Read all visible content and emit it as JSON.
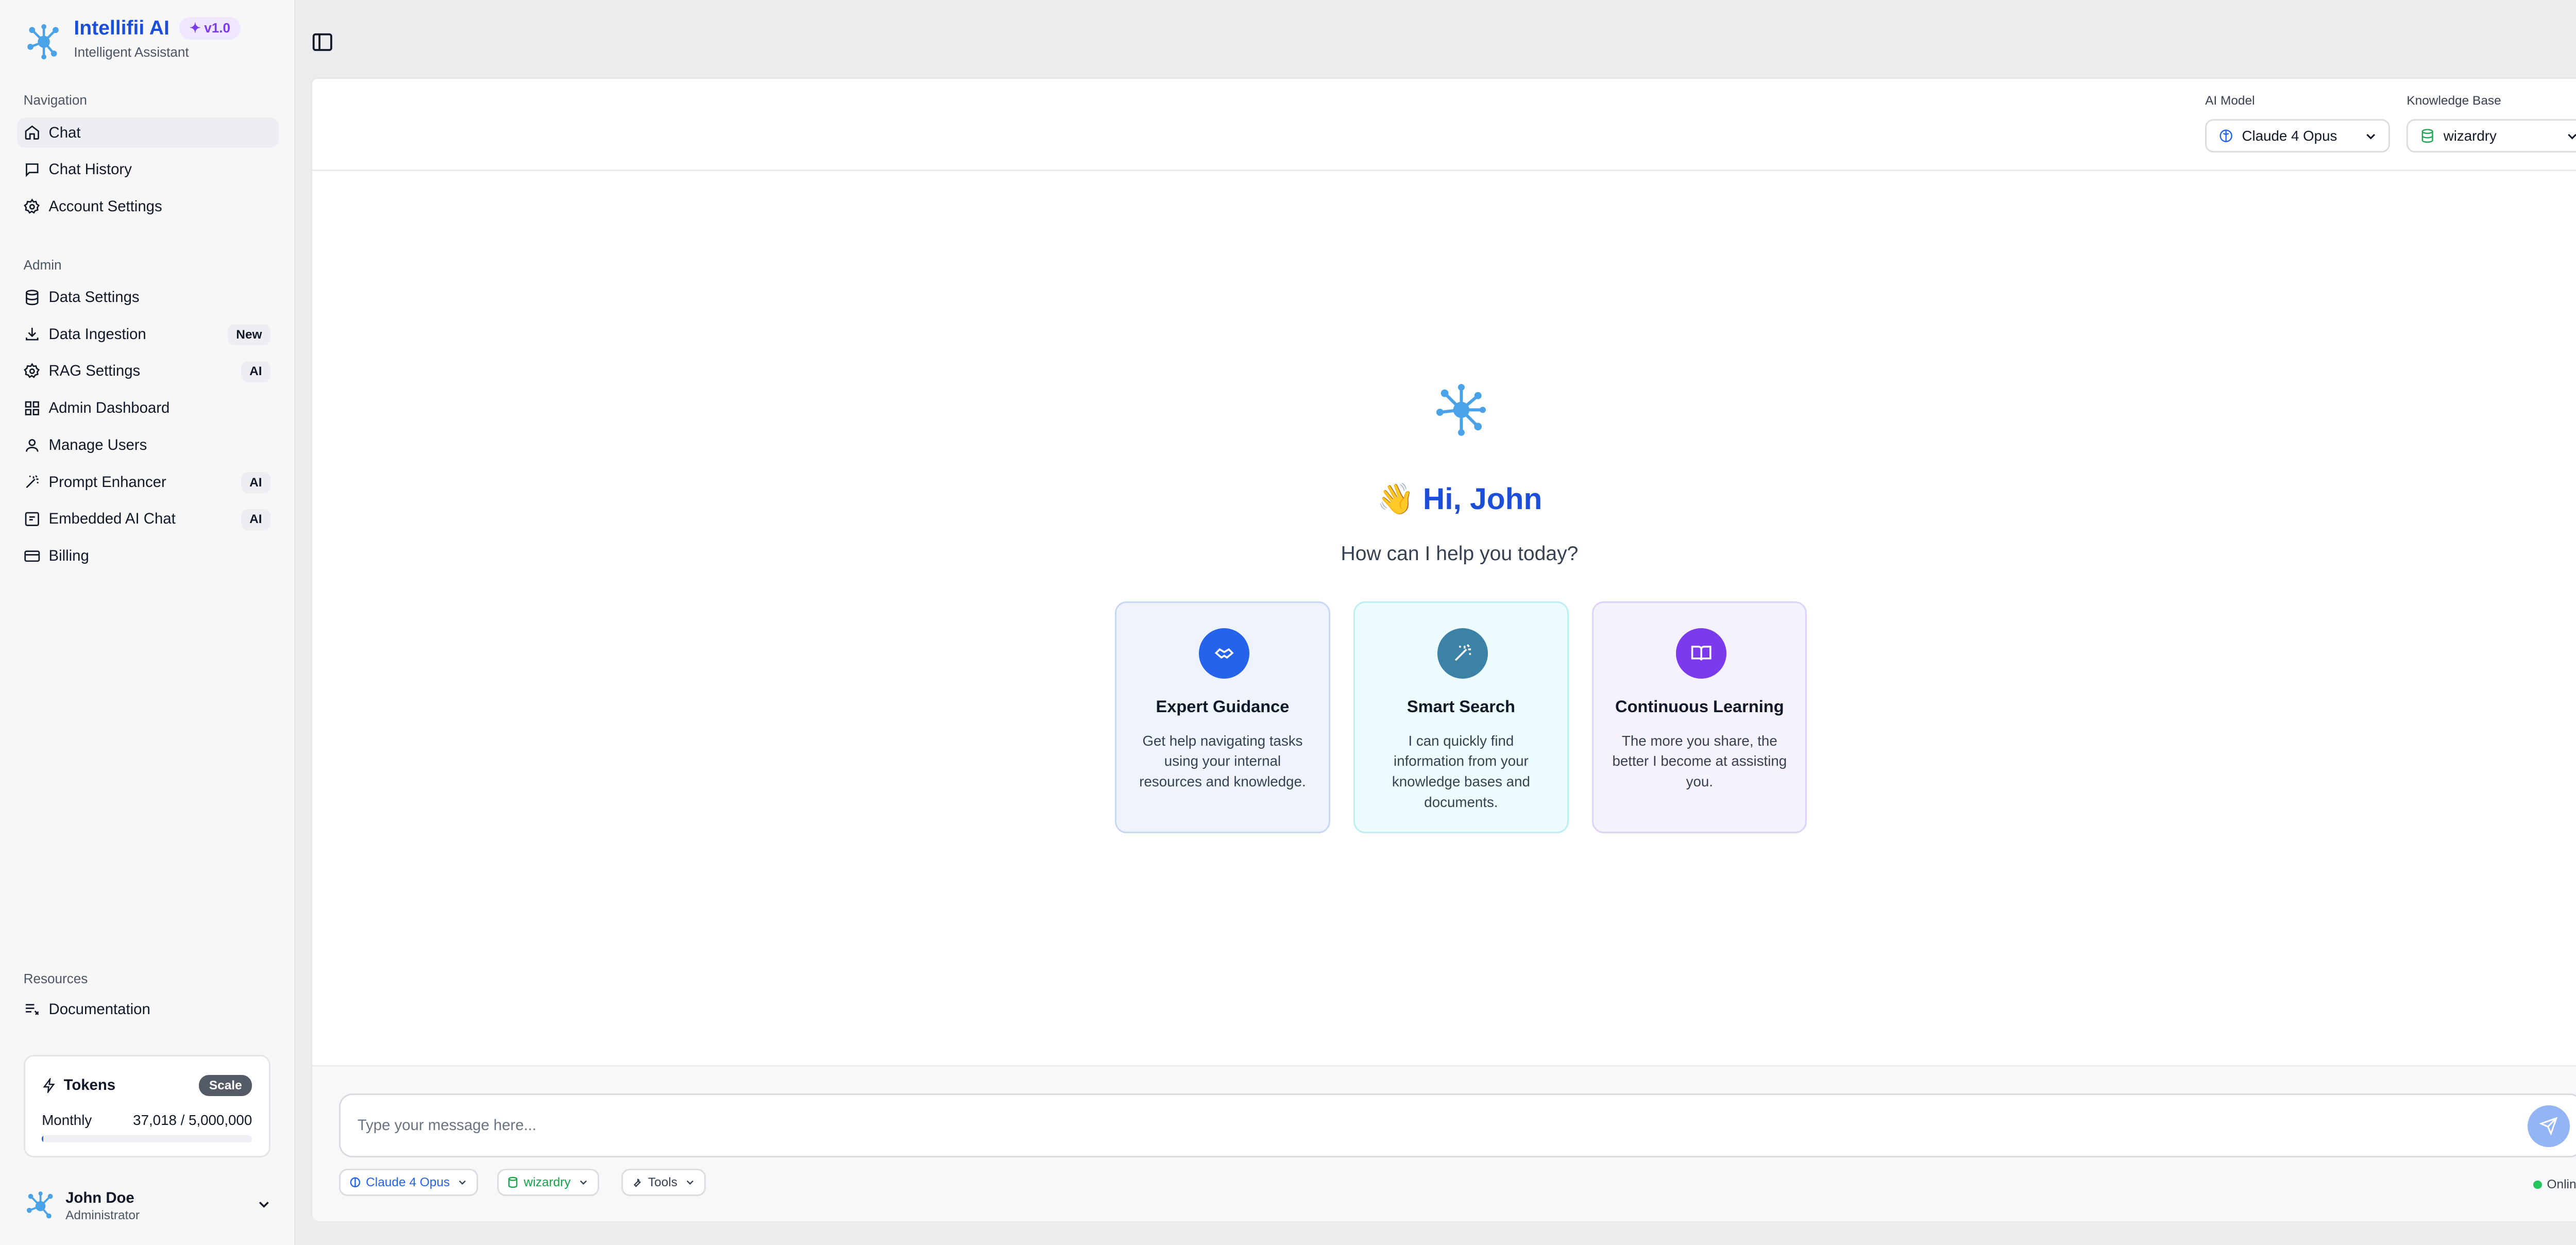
{
  "brand": {
    "name": "Intellifii AI",
    "version": "v1.0",
    "tagline": "Intelligent Assistant"
  },
  "nav": {
    "section_label": "Navigation",
    "items": [
      {
        "label": "Chat",
        "icon": "home-icon"
      },
      {
        "label": "Chat History",
        "icon": "message-icon"
      },
      {
        "label": "Account Settings",
        "icon": "gear-icon"
      }
    ]
  },
  "admin": {
    "section_label": "Admin",
    "items": [
      {
        "label": "Data Settings",
        "icon": "database-icon"
      },
      {
        "label": "Data Ingestion",
        "icon": "download-icon",
        "badge": "New"
      },
      {
        "label": "RAG Settings",
        "icon": "gear-icon",
        "badge": "AI"
      },
      {
        "label": "Admin Dashboard",
        "icon": "grid-icon"
      },
      {
        "label": "Manage Users",
        "icon": "user-icon"
      },
      {
        "label": "Prompt Enhancer",
        "icon": "wand-icon",
        "badge": "AI"
      },
      {
        "label": "Embedded AI Chat",
        "icon": "embed-icon",
        "badge": "AI"
      },
      {
        "label": "Billing",
        "icon": "card-icon"
      }
    ]
  },
  "resources": {
    "section_label": "Resources",
    "items": [
      {
        "label": "Documentation",
        "icon": "docs-icon"
      }
    ]
  },
  "tokens": {
    "title": "Tokens",
    "plan": "Scale",
    "period": "Monthly",
    "usage": "37,018 / 5,000,000",
    "used_fraction": 0.0074
  },
  "user": {
    "name": "John Doe",
    "role": "Administrator"
  },
  "header": {
    "model_label": "AI Model",
    "model_value": "Claude 4 Opus",
    "kb_label": "Knowledge Base",
    "kb_value": "wizardry"
  },
  "hero": {
    "greeting": "👋 Hi, John",
    "subtitle": "How can I help you today?",
    "cards": [
      {
        "title": "Expert Guidance",
        "desc": "Get help navigating tasks using your internal resources and knowledge."
      },
      {
        "title": "Smart Search",
        "desc": "I can quickly find information from your knowledge bases and documents."
      },
      {
        "title": "Continuous Learning",
        "desc": "The more you share, the better I become at assisting you."
      }
    ]
  },
  "composer": {
    "placeholder": "Type your message here...",
    "model_chip": "Claude 4 Opus",
    "kb_chip": "wizardry",
    "tools_chip": "Tools",
    "status": "Online"
  },
  "colors": {
    "accent": "#1d4ed8",
    "card1": "#2563eb",
    "card2": "#3b82a6",
    "card3": "#7c3aed"
  }
}
